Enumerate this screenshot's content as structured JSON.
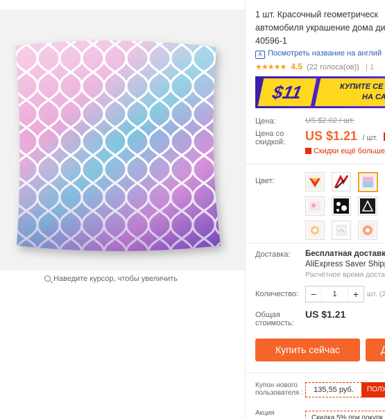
{
  "product": {
    "title_lines": [
      "1 шт. Красочный геометрическ",
      "автомобиля украшение дома ди",
      "40596-1"
    ],
    "translate_link": "Посмотреть название на англий",
    "rating": {
      "stars": "★★★★★",
      "score": "4.5",
      "votes": "(22 голоса(ов))",
      "sep": "| 1"
    }
  },
  "banner": {
    "amount": "$11",
    "cta_line1": "КУПИТЕ СЕ",
    "cta_line2": "НА СА"
  },
  "price": {
    "label": "Цена:",
    "old": "US $2.02 / шт.",
    "sale_label": "Цена со скидкой:",
    "new": "US $1.21",
    "unit": "/ шт.",
    "badge": "-4",
    "more_discounts": "Скидки ещё больше"
  },
  "color": {
    "label": "Цвет:",
    "selected_index": 2,
    "swatch_count": 12
  },
  "shipping": {
    "label": "Доставка:",
    "free": "Бесплатная доставка в",
    "service": "AliExpress Saver Shippi",
    "estimate": "Расчётное время достав"
  },
  "quantity": {
    "label": "Количество:",
    "value": "1",
    "minus": "−",
    "plus": "+",
    "unit": "шт. (2"
  },
  "total": {
    "label": "Общая стоимость:",
    "value": "US $1.21"
  },
  "buttons": {
    "buy_now": "Купить сейчас",
    "add_to_cart": "Д"
  },
  "coupon": {
    "label": "Купон нового пользователя :",
    "value": "135,55 руб.",
    "get": "ПОЛУ"
  },
  "promo": {
    "label": "Акция",
    "value": "Скидка 5% при покупк"
  },
  "zoom_hint": "Наведите курсор, чтобы увеличить",
  "colors": {
    "accent": "#f5652a",
    "red": "#e62e04",
    "star": "#f0a31c",
    "link": "#2a5cc1"
  }
}
